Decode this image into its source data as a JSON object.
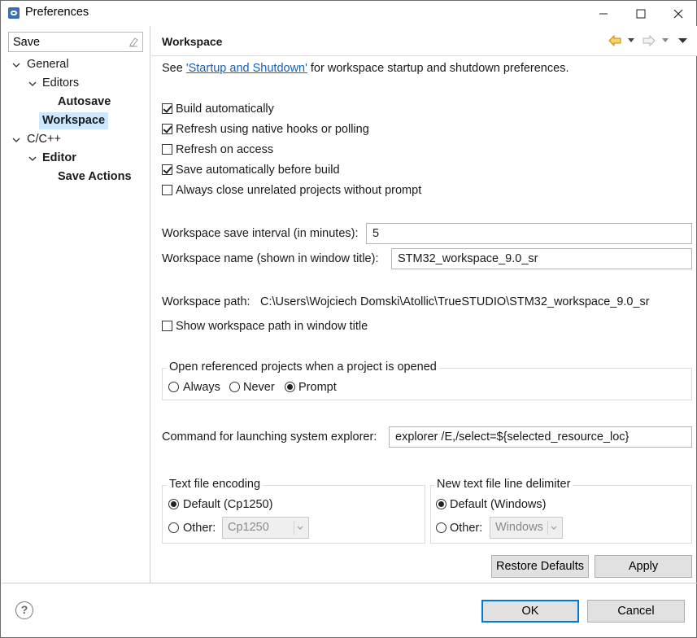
{
  "window": {
    "title": "Preferences",
    "minimize_icon": "minimize-icon",
    "maximize_icon": "maximize-icon",
    "close_icon": "close-icon"
  },
  "filter": {
    "value": "Save",
    "clear_icon": "eraser-icon"
  },
  "tree": {
    "general": "General",
    "editors": "Editors",
    "autosave": "Autosave",
    "workspace": "Workspace",
    "cpp": "C/C++",
    "editor": "Editor",
    "save_actions": "Save Actions"
  },
  "page": {
    "title": "Workspace",
    "intro_prefix": "See ",
    "intro_link": "'Startup and Shutdown'",
    "intro_suffix": " for workspace startup and shutdown preferences.",
    "checks": [
      {
        "label": "Build automatically",
        "checked": true
      },
      {
        "label": "Refresh using native hooks or polling",
        "checked": true
      },
      {
        "label": "Refresh on access",
        "checked": false
      },
      {
        "label": "Save automatically before build",
        "checked": true
      },
      {
        "label": "Always close unrelated projects without prompt",
        "checked": false
      }
    ],
    "save_interval_label": "Workspace save interval (in minutes):",
    "save_interval_value": "5",
    "ws_name_label": "Workspace name (shown in window title):",
    "ws_name_value": "STM32_workspace_9.0_sr",
    "ws_path_label": "Workspace path:",
    "ws_path_value": "C:\\Users\\Wojciech Domski\\Atollic\\TrueSTUDIO\\STM32_workspace_9.0_sr",
    "show_path_label": "Show workspace path in window title",
    "show_path_checked": false,
    "open_ref_title": "Open referenced projects when a project is opened",
    "open_ref_options": [
      "Always",
      "Never",
      "Prompt"
    ],
    "open_ref_selected": "Prompt",
    "explorer_label": "Command for launching system explorer:",
    "explorer_value": "explorer /E,/select=${selected_resource_loc}",
    "encoding_title": "Text file encoding",
    "encoding_default": "Default (Cp1250)",
    "encoding_other": "Other:",
    "encoding_combo": "Cp1250",
    "delimiter_title": "New text file line delimiter",
    "delimiter_default": "Default (Windows)",
    "delimiter_other": "Other:",
    "delimiter_combo": "Windows",
    "restore_defaults": "Restore Defaults",
    "apply": "Apply"
  },
  "footer": {
    "help_icon": "help-icon",
    "help_glyph": "?",
    "ok": "OK",
    "cancel": "Cancel"
  },
  "colors": {
    "selection": "#cce8ff",
    "link": "#1a5fb4",
    "default_button_border": "#0078d7",
    "back_arrow": "#e8a200"
  }
}
